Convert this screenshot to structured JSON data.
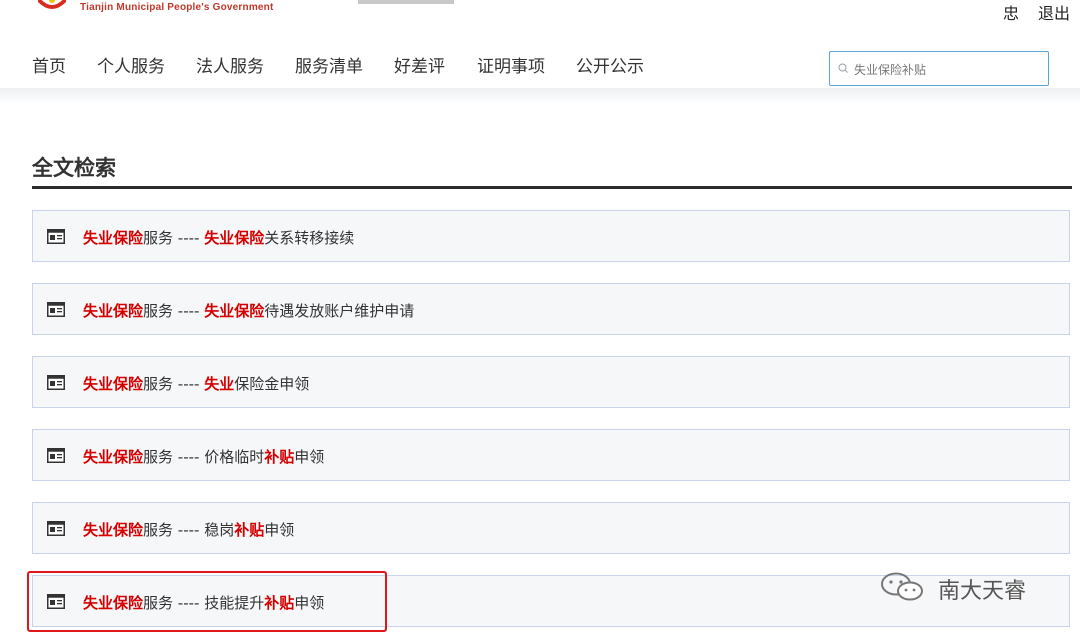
{
  "header": {
    "org_en": "Tianjin Municipal People's Government",
    "user_name": "忠",
    "logout_label": "退出"
  },
  "nav": {
    "items": [
      {
        "label": "首页"
      },
      {
        "label": "个人服务"
      },
      {
        "label": "法人服务"
      },
      {
        "label": "服务清单"
      },
      {
        "label": "好差评"
      },
      {
        "label": "证明事项"
      },
      {
        "label": "公开公示"
      }
    ]
  },
  "search": {
    "value": "失业保险补贴"
  },
  "section": {
    "title": "全文检索"
  },
  "results": [
    {
      "segments": [
        {
          "text": "失业保险",
          "hl": true
        },
        {
          "text": "服务 ---- ",
          "hl": false
        },
        {
          "text": "失业保险",
          "hl": true
        },
        {
          "text": "关系转移接续",
          "hl": false
        }
      ]
    },
    {
      "segments": [
        {
          "text": "失业保险",
          "hl": true
        },
        {
          "text": "服务 ---- ",
          "hl": false
        },
        {
          "text": "失业保险",
          "hl": true
        },
        {
          "text": "待遇发放账户维护申请",
          "hl": false
        }
      ]
    },
    {
      "segments": [
        {
          "text": "失业保险",
          "hl": true
        },
        {
          "text": "服务 ---- ",
          "hl": false
        },
        {
          "text": "失业",
          "hl": true
        },
        {
          "text": "保险金申领",
          "hl": false
        }
      ]
    },
    {
      "segments": [
        {
          "text": "失业保险",
          "hl": true
        },
        {
          "text": "服务 ---- 价格临时",
          "hl": false
        },
        {
          "text": "补贴",
          "hl": true
        },
        {
          "text": "申领",
          "hl": false
        }
      ]
    },
    {
      "segments": [
        {
          "text": "失业保险",
          "hl": true
        },
        {
          "text": "服务 ---- 稳岗",
          "hl": false
        },
        {
          "text": "补贴",
          "hl": true
        },
        {
          "text": "申领",
          "hl": false
        }
      ]
    },
    {
      "segments": [
        {
          "text": "失业保险",
          "hl": true
        },
        {
          "text": "服务 ---- 技能提升",
          "hl": false
        },
        {
          "text": "补贴",
          "hl": true
        },
        {
          "text": "申领",
          "hl": false
        }
      ]
    }
  ],
  "watermark": {
    "text": "南大天睿"
  },
  "colors": {
    "highlight": "#d40000",
    "accent_border": "#5aa5d6",
    "frame": "#e0161b"
  }
}
